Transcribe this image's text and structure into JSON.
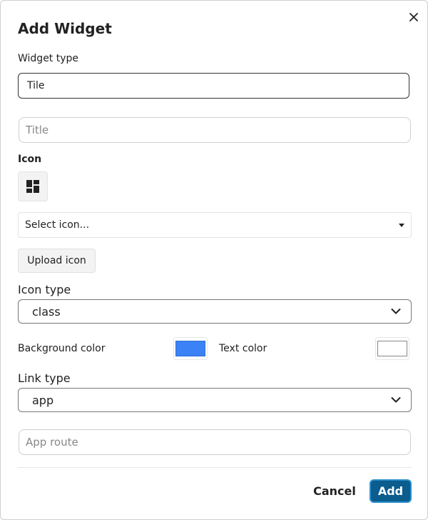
{
  "dialog": {
    "title": "Add Widget",
    "close_icon": "close-icon"
  },
  "form": {
    "widget_type": {
      "label": "Widget type",
      "value": "Tile"
    },
    "title_field": {
      "placeholder": "Title",
      "value": ""
    },
    "icon": {
      "label": "Icon",
      "preview_icon": "dashboard-icon",
      "select_placeholder": "Select icon...",
      "upload_label": "Upload icon"
    },
    "icon_type": {
      "label": "Icon type",
      "value": "class"
    },
    "colors": {
      "background_label": "Background color",
      "background_value": "#3b82f6",
      "text_label": "Text color",
      "text_value": "#ffffff"
    },
    "link_type": {
      "label": "Link type",
      "value": "app"
    },
    "app_route": {
      "placeholder": "App route",
      "value": ""
    }
  },
  "footer": {
    "cancel_label": "Cancel",
    "add_label": "Add",
    "primary_color": "#0a5d8c"
  }
}
